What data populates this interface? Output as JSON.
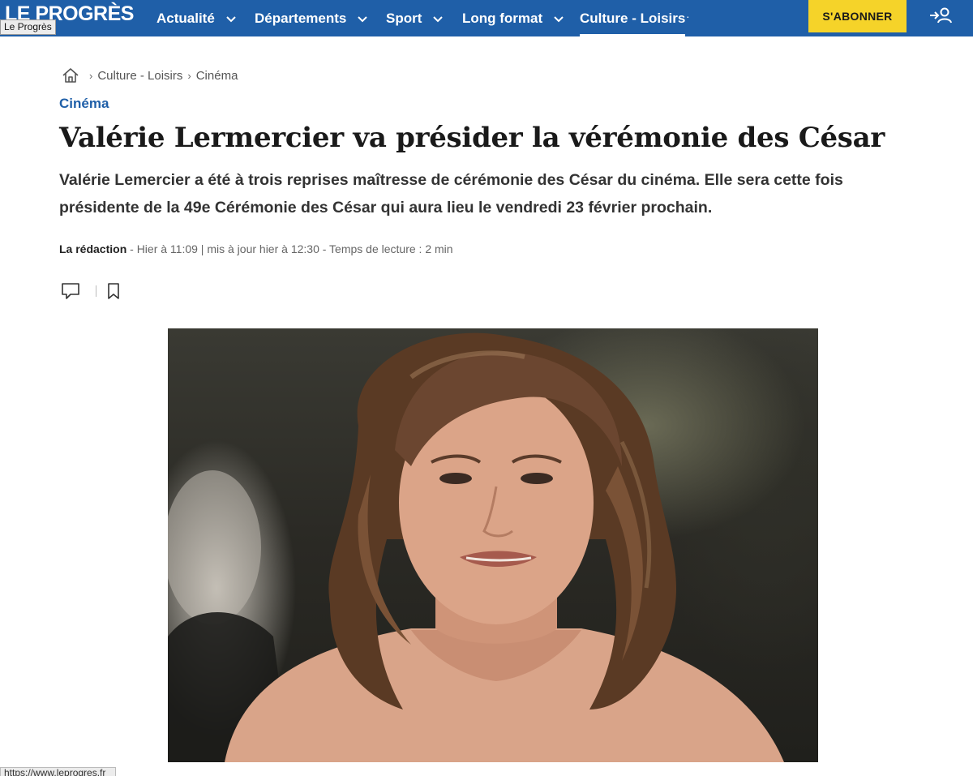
{
  "header": {
    "logo_text": "LE PROGRÈS",
    "logo_tooltip": "Le Progrès",
    "nav": [
      {
        "label": "Actualité"
      },
      {
        "label": "Départements"
      },
      {
        "label": "Sport"
      },
      {
        "label": "Long format"
      },
      {
        "label": "Culture - Loisirs"
      }
    ],
    "subscribe_label": "S'ABONNER",
    "brand_color": "#1f5fa8",
    "accent_color": "#f5d329"
  },
  "breadcrumb": {
    "items": [
      "Culture - Loisirs",
      "Cinéma"
    ]
  },
  "article": {
    "section": "Cinéma",
    "headline": "Valérie Lermercier va présider la vérémonie des César",
    "lede": "Valérie Lemercier a été à trois reprises maîtresse de cérémonie des César du cinéma. Elle sera cette fois présidente de la 49e Cérémonie des César qui aura lieu le vendredi 23 février prochain.",
    "author": "La rédaction",
    "byline_rest": " - Hier à 11:09 | mis à jour hier à 12:30 - Temps de lecture : 2 min"
  },
  "icons": {
    "home": "home-icon",
    "comment": "comment-icon",
    "bookmark": "bookmark-icon",
    "login": "login-icon",
    "chevron": "chevron-down-icon"
  },
  "status_bar": {
    "url": "https://www.leprogres.fr"
  }
}
